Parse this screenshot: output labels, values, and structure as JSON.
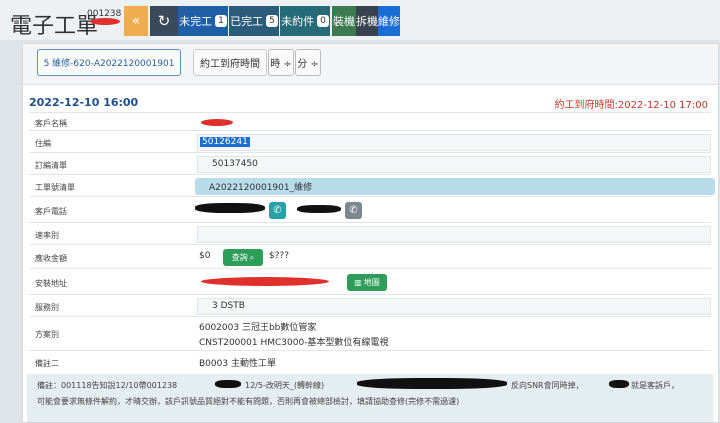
{
  "header": {
    "title": "電子工單",
    "order_id": "001238",
    "buttons": {
      "back": "«",
      "refresh": "↻",
      "undone_label": "未完工",
      "undone_count": "1",
      "done_label": "已完工",
      "done_count": "5",
      "unbooked_label": "未約件",
      "unbooked_count": "0",
      "install": "裝機",
      "remove": "拆機",
      "repair": "維修"
    }
  },
  "toolbar": {
    "work_order_button": "5 維修-620-A2022120001901",
    "appointment_label": "約工到府時間",
    "hour_select": "時 ÷",
    "minute_select": "分 ÷"
  },
  "detail": {
    "date": "2022-12-10 16:00",
    "appointment_time": "約工到府時間:2022-12-10 17:00",
    "fields": {
      "customer_name_label": "客戶名稱",
      "residence_label": "住編",
      "residence_value": "50126241",
      "order_list_label": "訂編清單",
      "order_list_value": "50137450",
      "work_order_list_label": "工單號清單",
      "work_order_list_value": "A2022120001901_維修",
      "phone_label": "客戶電話",
      "speed_label": "速率別",
      "receivable_label": "應收金額",
      "receivable_value": "$0",
      "query_button": "查詢",
      "query_result": "$???",
      "address_label": "安裝地址",
      "map_button": "地圖",
      "service_label": "服務別",
      "service_value": "3 DSTB",
      "plan_label": "方案別",
      "plan_line1": "6002003 三冠王bb數位管家",
      "plan_line2": "CNST200001 HMC3000-基本型數位有線電視",
      "remark2_label": "備註二",
      "remark2_value": "B0003 主動性工單"
    },
    "note": {
      "line1_start": "備註：001118告知說12/10帶001238",
      "line1_mid": "12/5-改明天_(轉幹線)",
      "line1_end": "反向SNR會同時掉，",
      "line1_tail": "就是客訴戶，",
      "line2": "可能會要求無條件解約，才晴交辦，該戶訊號品質絕對不能有問題，否則再會被總部檢討，填請協助查修(完修不需過濾)"
    }
  },
  "colors": {
    "brand_blue": "#1f4f86",
    "alert_red": "#c0392b",
    "green": "#2e9d5a",
    "teal": "#27a3a8"
  }
}
